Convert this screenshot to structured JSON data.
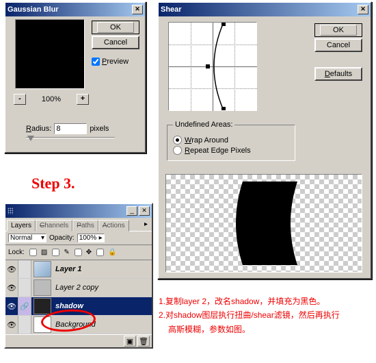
{
  "gaussian": {
    "title": "Gaussian Blur",
    "ok": "OK",
    "cancel": "Cancel",
    "preview_label": "Preview",
    "zoom_pct": "100%",
    "radius_label": "Radius:",
    "radius_value": "8",
    "radius_unit": "pixels",
    "minus": "-",
    "plus": "+"
  },
  "shear": {
    "title": "Shear",
    "ok": "OK",
    "cancel": "Cancel",
    "defaults": "Defaults",
    "undefined_areas": "Undefined Areas:",
    "wrap": "Wrap Around",
    "repeat": "Repeat Edge Pixels"
  },
  "step_label": "Step 3.",
  "layers": {
    "tabs": [
      "Layers",
      "Channels",
      "Paths",
      "Actions"
    ],
    "blend_mode": "Normal",
    "opacity_label": "Opacity:",
    "opacity_value": "100%",
    "lock_label": "Lock:",
    "rows": [
      {
        "name": "Layer 1",
        "selected": false,
        "linked": false
      },
      {
        "name": "Layer 2 copy",
        "selected": false,
        "linked": false
      },
      {
        "name": "shadow",
        "selected": true,
        "linked": true
      },
      {
        "name": "Background",
        "selected": false,
        "linked": false
      }
    ]
  },
  "instructions": {
    "line1": "1.复制layer 2，改名shadow，并填充为黑色。",
    "line2": "2.对shadow图层执行扭曲/shear滤镜，然后再执行",
    "line3": "  高斯模糊，参数如图。"
  },
  "icons": {
    "close": "✕",
    "eye": "👁",
    "arrow": "▸",
    "drop": "▾"
  }
}
